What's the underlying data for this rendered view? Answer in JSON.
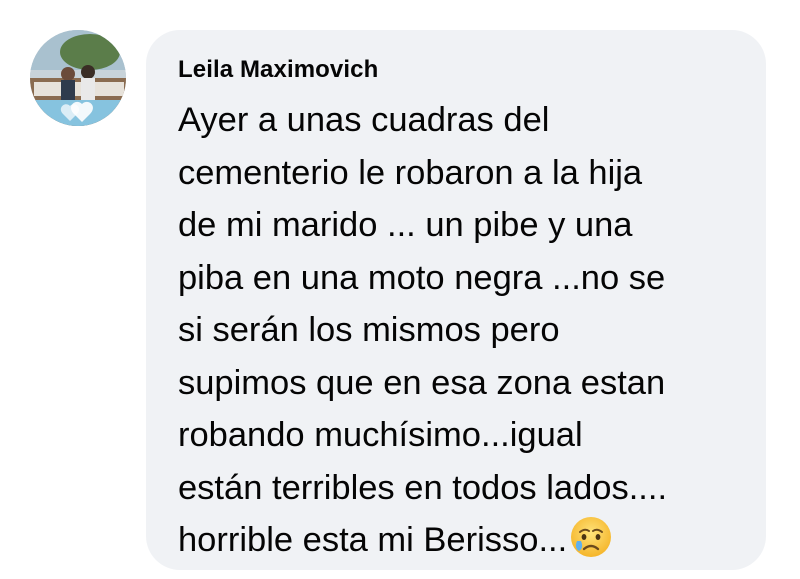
{
  "comment": {
    "author": "Leila Maximovich",
    "lines": [
      "Ayer a unas cuadras del",
      "cementerio le robaron a la hija",
      "de mi marido ... un pibe y una",
      "piba en una moto negra ...no se",
      "si serán los mismos pero",
      "supimos que en esa zona estan",
      "robando muchísimo...igual",
      "están terribles en todos lados....",
      "horrible esta mi Berisso..."
    ],
    "emoji_icon": "sad-but-relieved-face-icon"
  },
  "colors": {
    "bubble_bg": "#f0f2f5",
    "text": "#050505",
    "page_bg": "#ffffff"
  }
}
